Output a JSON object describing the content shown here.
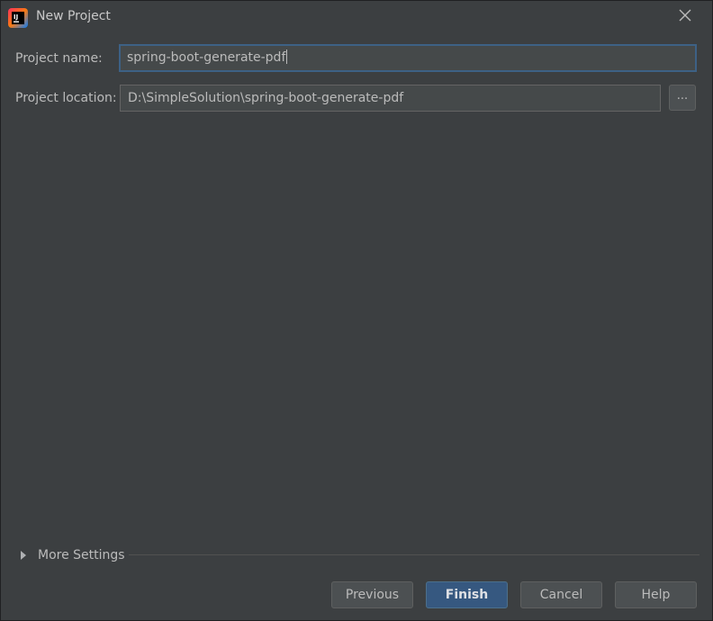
{
  "window": {
    "title": "New Project",
    "app_icon": "intellij-idea-icon",
    "close_icon": "close-icon"
  },
  "form": {
    "project_name": {
      "label": "Project name:",
      "value": "spring-boot-generate-pdf"
    },
    "project_location": {
      "label": "Project location:",
      "value": "D:\\SimpleSolution\\spring-boot-generate-pdf",
      "browse_label": "..."
    }
  },
  "more_settings": {
    "label": "More Settings",
    "expanded": false
  },
  "buttons": {
    "previous": "Previous",
    "finish": "Finish",
    "cancel": "Cancel",
    "help": "Help"
  },
  "colors": {
    "background": "#3c3f41",
    "accent": "#365880",
    "focus_border": "#3d6185"
  }
}
